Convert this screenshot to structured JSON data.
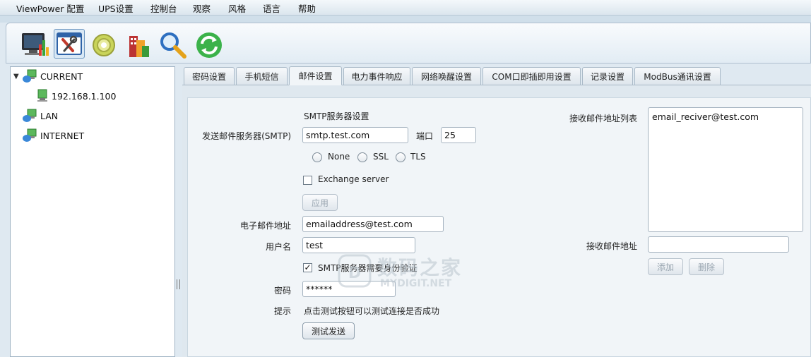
{
  "menu": [
    "ViewPower 配置",
    "UPS设置",
    "控制台",
    "观察",
    "风格",
    "语言",
    "帮助"
  ],
  "toolbar": {
    "icons": [
      "monitor-chart-icon",
      "config-tools-icon",
      "sun-settings-icon",
      "building-chart-icon",
      "magnifier-icon",
      "refresh-icon"
    ]
  },
  "tree": {
    "current": "CURRENT",
    "ip": "192.168.1.100",
    "lan": "LAN",
    "internet": "INTERNET"
  },
  "tabs": [
    "密码设置",
    "手机短信",
    "邮件设置",
    "电力事件响应",
    "网络唤醒设置",
    "COM口即插即用设置",
    "记录设置",
    "ModBus通讯设置"
  ],
  "active_tab": "邮件设置",
  "form": {
    "smtp_section_title": "SMTP服务器设置",
    "smtp_server_label": "发送邮件服务器(SMTP)",
    "smtp_server_value": "smtp.test.com",
    "port_label": "端口",
    "port_value": "25",
    "security_options": [
      "None",
      "SSL",
      "TLS"
    ],
    "exchange_label": "Exchange server",
    "apply_button": "应用",
    "email_label": "电子邮件地址",
    "email_value": "emailaddress@test.com",
    "username_label": "用户名",
    "username_value": "test",
    "auth_label": "SMTP服务器需要身份验证",
    "password_label": "密码",
    "password_value": "******",
    "hint_label": "提示",
    "hint_text": "点击测试按钮可以测试连接是否成功",
    "test_button": "测试发送"
  },
  "recipients": {
    "list_label": "接收邮件地址列表",
    "list_items": [
      "email_reciver@test.com"
    ],
    "address_label": "接收邮件地址",
    "address_value": "",
    "add_button": "添加",
    "delete_button": "删除"
  },
  "watermark": {
    "brand_cn": "数码之家",
    "brand_en": "MYDIGIT.NET"
  },
  "colors": {
    "panel_bg": "#f1f5f8",
    "tab_border": "#a9b9c7",
    "disabled_text": "#9aa6b1"
  }
}
